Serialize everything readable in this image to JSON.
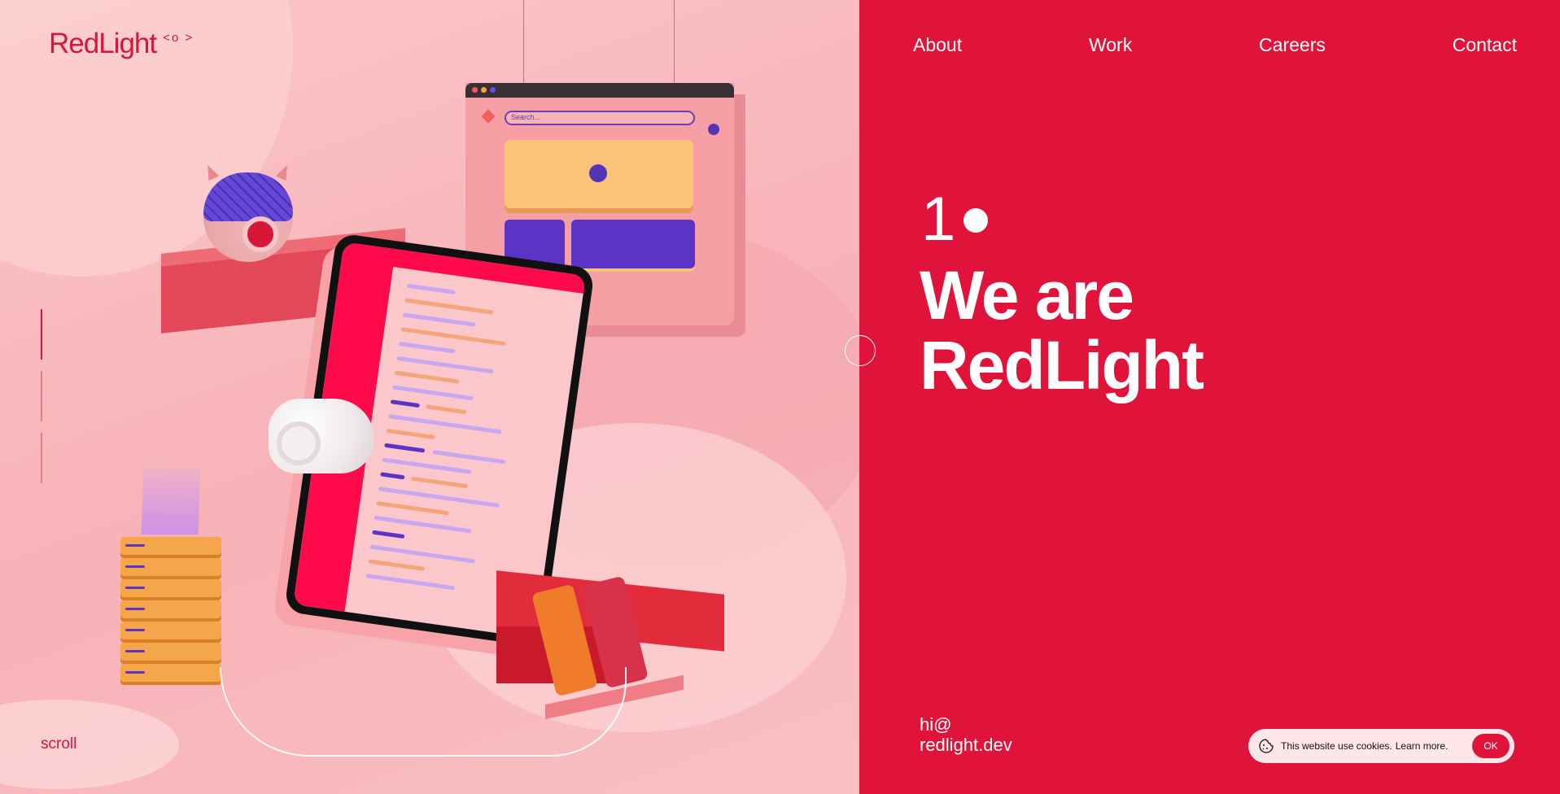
{
  "brand": {
    "logo": "RedLight",
    "logo_mark": "<o >"
  },
  "nav": {
    "items": [
      "About",
      "Work",
      "Careers",
      "Contact"
    ]
  },
  "hero": {
    "number": "1",
    "title_line1": "We are",
    "title_line2": "RedLight"
  },
  "illustration": {
    "search_placeholder": "Search..."
  },
  "scroll": {
    "label": "scroll"
  },
  "contact": {
    "email_line1": "hi@",
    "email_line2": "redlight.dev"
  },
  "cookie_banner": {
    "text": "This website use cookies.",
    "link": "Learn more.",
    "button": "OK"
  },
  "colors": {
    "accent_red": "#e0143a",
    "pink_bg": "#f7b2b7",
    "white": "#ffffff"
  },
  "icons": [
    "cookie-icon"
  ]
}
